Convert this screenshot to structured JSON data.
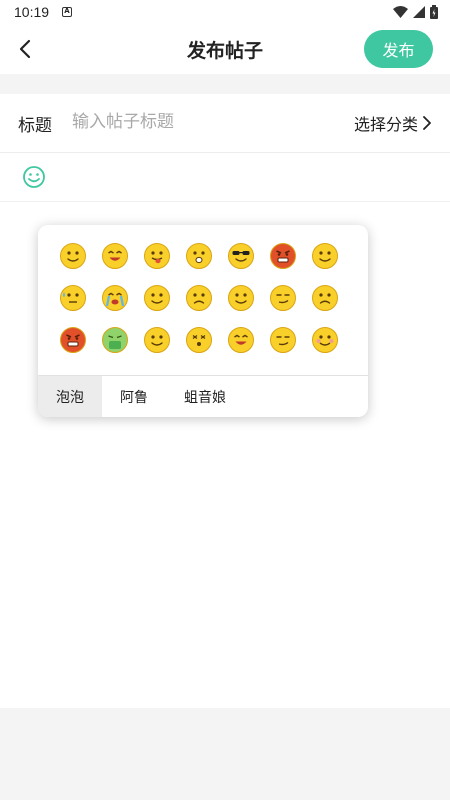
{
  "status_bar": {
    "time": "10:19",
    "notif_glyph": "A"
  },
  "header": {
    "title": "发布帖子",
    "publish_label": "发布"
  },
  "post": {
    "title_label": "标题",
    "title_placeholder": "输入帖子标题",
    "category_label": "选择分类"
  },
  "emoji_panel": {
    "tabs": [
      {
        "label": "泡泡",
        "active": true
      },
      {
        "label": "阿鲁",
        "active": false
      },
      {
        "label": "蛆音娘",
        "active": false
      }
    ],
    "emojis": [
      "smile",
      "laugh",
      "tongue",
      "surprised",
      "cool",
      "angry",
      "grin",
      "sweat",
      "cry",
      "salute",
      "frown",
      "thinking",
      "smirk",
      "sad",
      "red-angry",
      "vomit",
      "shy",
      "dizzy",
      "squint-laugh",
      "smug",
      "blush"
    ]
  },
  "colors": {
    "accent": "#3ec7a0",
    "emoji_yellow": "#f9cf2a",
    "background": "#ffffff"
  }
}
